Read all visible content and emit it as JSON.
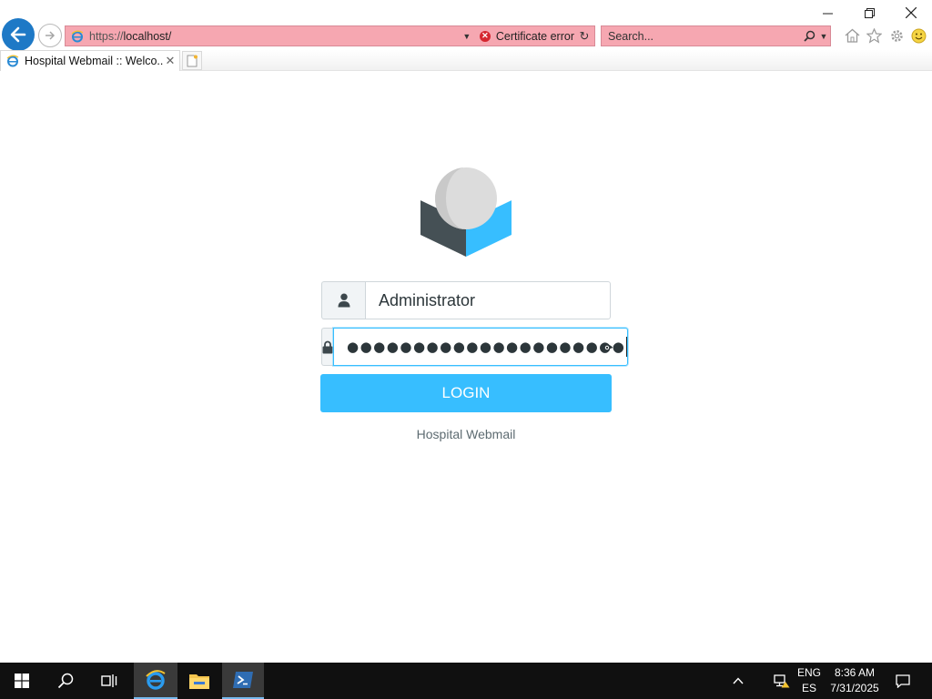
{
  "browser": {
    "address": {
      "protocol": "https://",
      "host": "localhost/"
    },
    "certificate_error": "Certificate error",
    "search_placeholder": "Search...",
    "tab_title": "Hospital Webmail :: Welco...",
    "icons": [
      "back-arrow-icon",
      "forward-arrow-icon",
      "ie-logo-icon",
      "certificate-error-icon",
      "refresh-icon",
      "search-icon",
      "home-icon",
      "favorites-star-icon",
      "settings-gear-icon",
      "feedback-smiley-icon",
      "close-tab-icon",
      "new-tab-icon"
    ]
  },
  "login": {
    "username": "Administrator",
    "password_mask": "●●●●●●●●●●●●●●●●●●●●●",
    "button_label": "LOGIN",
    "product_name": "Hospital Webmail"
  },
  "taskbar": {
    "lang_top": "ENG",
    "lang_bottom": "ES",
    "time": "8:36 AM",
    "date": "7/31/2025"
  },
  "colors": {
    "accent": "#37beff",
    "logo_dark": "#455055",
    "logo_light": "#dcdcdc",
    "address_error_bg": "#f6a7b1",
    "ie_back_button": "#1e79c6"
  }
}
